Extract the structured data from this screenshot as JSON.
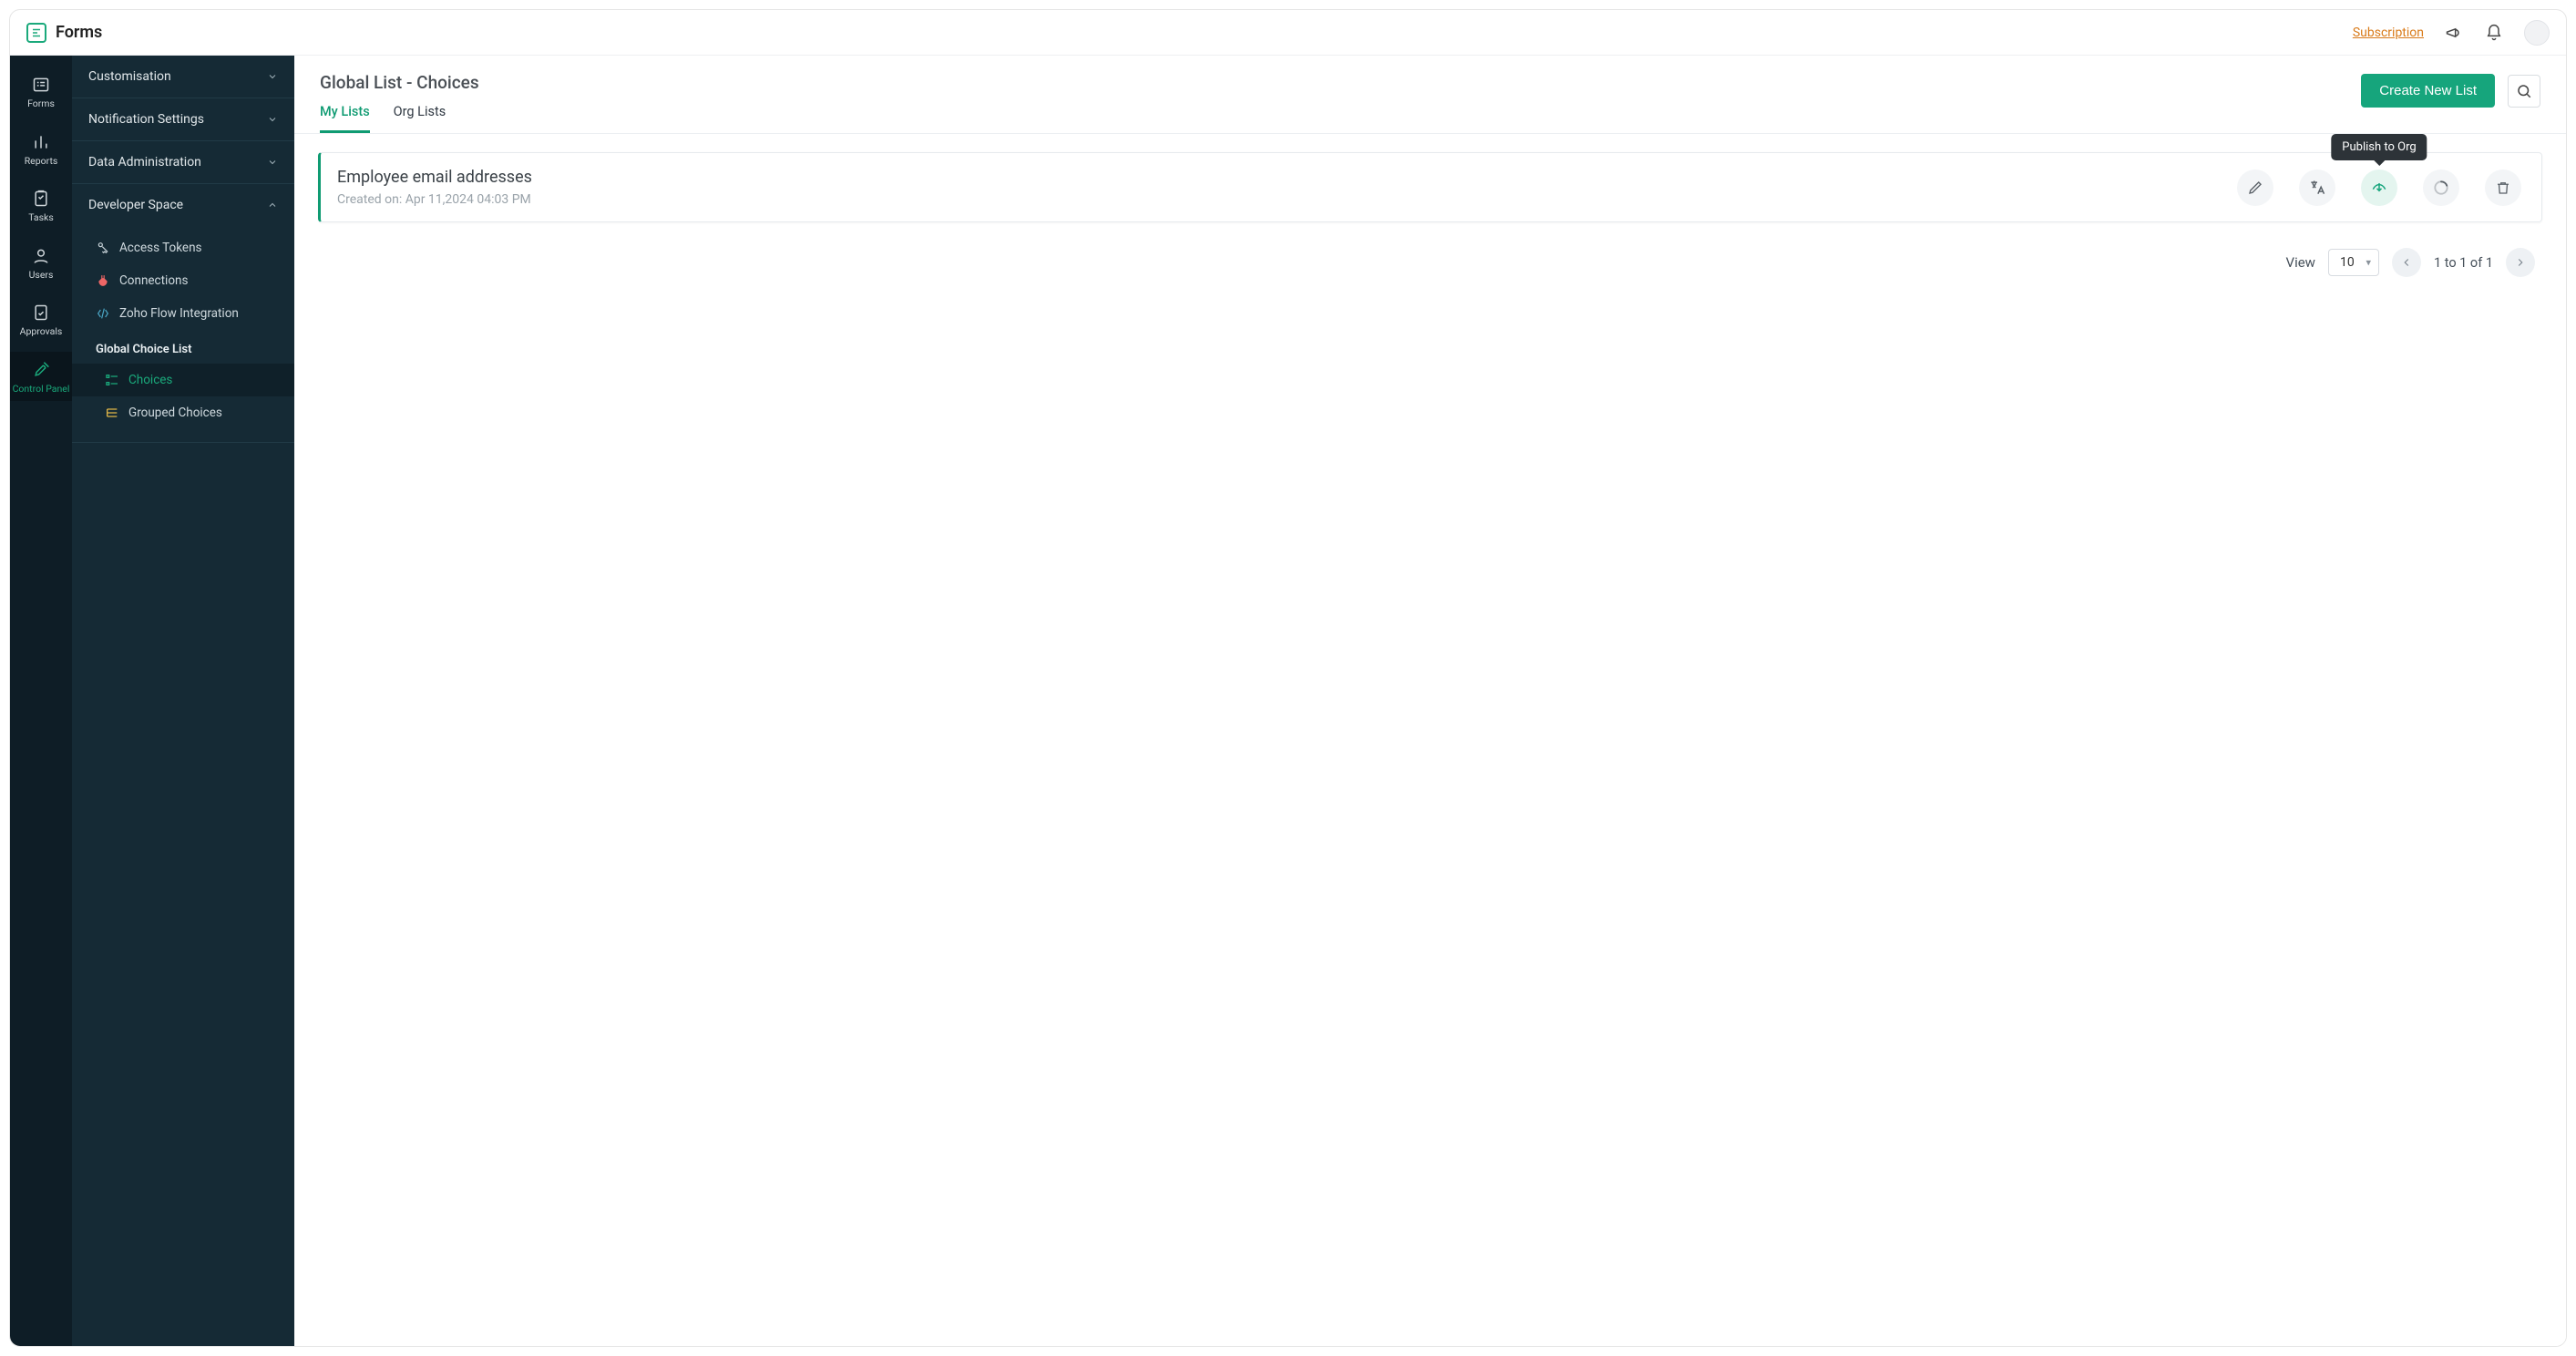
{
  "topbar": {
    "app_name": "Forms",
    "subscription": "Subscription"
  },
  "rail": {
    "items": [
      {
        "key": "forms",
        "label": "Forms"
      },
      {
        "key": "reports",
        "label": "Reports"
      },
      {
        "key": "tasks",
        "label": "Tasks"
      },
      {
        "key": "users",
        "label": "Users"
      },
      {
        "key": "approvals",
        "label": "Approvals"
      },
      {
        "key": "control_panel",
        "label": "Control Panel"
      }
    ],
    "active": "control_panel"
  },
  "sidebar": {
    "sections": {
      "customisation": "Customisation",
      "notification": "Notification Settings",
      "data_admin": "Data Administration",
      "developer_space": "Developer Space"
    },
    "developer_space": {
      "access_tokens": "Access Tokens",
      "connections": "Connections",
      "zoho_flow": "Zoho Flow Integration",
      "global_choice_header": "Global Choice List",
      "choices": "Choices",
      "grouped_choices": "Grouped Choices"
    },
    "active_leaf": "choices"
  },
  "main": {
    "title": "Global List - Choices",
    "tabs": {
      "my_lists": "My Lists",
      "org_lists": "Org Lists"
    },
    "active_tab": "my_lists",
    "create_btn": "Create New List"
  },
  "list_item": {
    "title": "Employee email addresses",
    "meta_prefix": "Created on: ",
    "created_on": "Apr 11,2024 04:03 PM",
    "tooltip_publish": "Publish to Org"
  },
  "pagination": {
    "view_label": "View",
    "page_size": "10",
    "status": "1 to 1 of 1"
  }
}
